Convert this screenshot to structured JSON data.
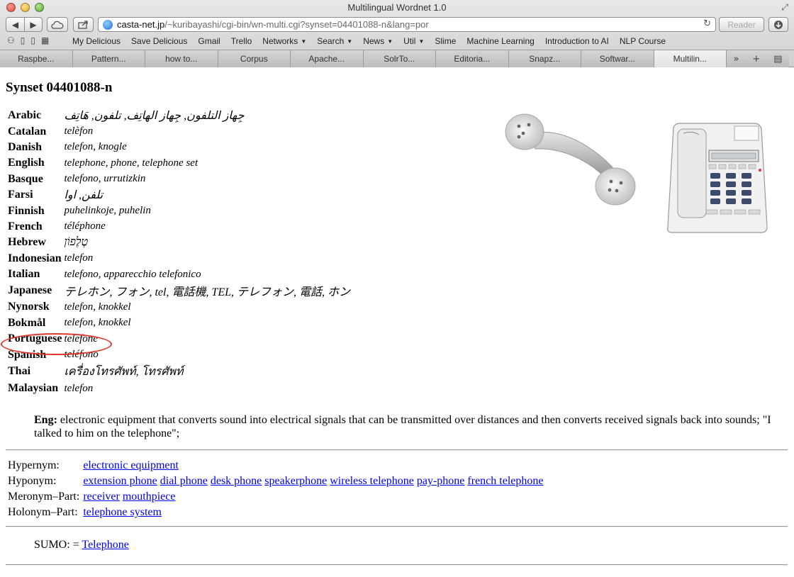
{
  "window": {
    "title": "Multilingual Wordnet 1.0"
  },
  "toolbar": {
    "url_host": "casta-net.jp",
    "url_path": "/~kuribayashi/cgi-bin/wn-multi.cgi?synset=04401088-n&lang=por",
    "reader_label": "Reader"
  },
  "bookmarks": [
    {
      "label": "My Delicious",
      "menu": false
    },
    {
      "label": "Save Delicious",
      "menu": false
    },
    {
      "label": "Gmail",
      "menu": false
    },
    {
      "label": "Trello",
      "menu": false
    },
    {
      "label": "Networks",
      "menu": true
    },
    {
      "label": "Search",
      "menu": true
    },
    {
      "label": "News",
      "menu": true
    },
    {
      "label": "Util",
      "menu": true
    },
    {
      "label": "Slime",
      "menu": false
    },
    {
      "label": "Machine Learning",
      "menu": false
    },
    {
      "label": "Introduction to AI",
      "menu": false
    },
    {
      "label": "NLP Course",
      "menu": false
    }
  ],
  "tabs": [
    "Raspbe...",
    "Pattern...",
    "how to...",
    "Corpus",
    "Apache...",
    "SolrTo...",
    "Editoria...",
    "Snapz...",
    "Softwar...",
    "Multilin..."
  ],
  "active_tab": 9,
  "page": {
    "synset_title": "Synset 04401088-n",
    "languages": [
      {
        "name": "Arabic",
        "words": "جِهاز التلفون, جِهاز الهاتِف, تلفون, هَاتِف"
      },
      {
        "name": "Catalan",
        "words": "telèfon"
      },
      {
        "name": "Danish",
        "words": "telefon, knogle"
      },
      {
        "name": "English",
        "words": "telephone, phone, telephone set"
      },
      {
        "name": "Basque",
        "words": "telefono, urrutizkin"
      },
      {
        "name": "Farsi",
        "words": "تلفن, اوا"
      },
      {
        "name": "Finnish",
        "words": "puhelinkoje, puhelin"
      },
      {
        "name": "French",
        "words": "téléphone"
      },
      {
        "name": "Hebrew",
        "words": "טֶלֶפוֹן"
      },
      {
        "name": "Indonesian",
        "words": "telefon"
      },
      {
        "name": "Italian",
        "words": "telefono, apparecchio telefonico"
      },
      {
        "name": "Japanese",
        "words": "テレホン, フォン, tel, 電話機, TEL, テレフォン, 電話, ホン"
      },
      {
        "name": "Nynorsk",
        "words": "telefon, knokkel"
      },
      {
        "name": "Bokmål",
        "words": "telefon, knokkel"
      },
      {
        "name": "Portuguese",
        "words": "telefone"
      },
      {
        "name": "Spanish",
        "words": "teléfono"
      },
      {
        "name": "Thai",
        "words": "เครื่องโทรศัพท์, โทรศัพท์"
      },
      {
        "name": "Malaysian",
        "words": "telefon"
      }
    ],
    "highlighted_language": "Portuguese",
    "gloss_label": "Eng:",
    "gloss_text": "electronic equipment that converts sound into electrical signals that can be transmitted over distances and then converts received signals back into sounds; \"I talked to him on the telephone\";",
    "relations": [
      {
        "name": "Hypernym:",
        "links": [
          "electronic equipment"
        ]
      },
      {
        "name": "Hyponym:",
        "links": [
          "extension phone",
          "dial phone",
          "desk phone",
          "speakerphone",
          "wireless telephone",
          "pay-phone",
          "french telephone"
        ]
      },
      {
        "name": "Meronym–Part:",
        "links": [
          "receiver",
          "mouthpiece"
        ]
      },
      {
        "name": "Holonym–Part:",
        "links": [
          "telephone system"
        ]
      }
    ],
    "sumo_label": "SUMO: =",
    "sumo_link": "Telephone"
  },
  "colors": {
    "link": "#0000ee",
    "highlight_circle": "#e0392b"
  }
}
